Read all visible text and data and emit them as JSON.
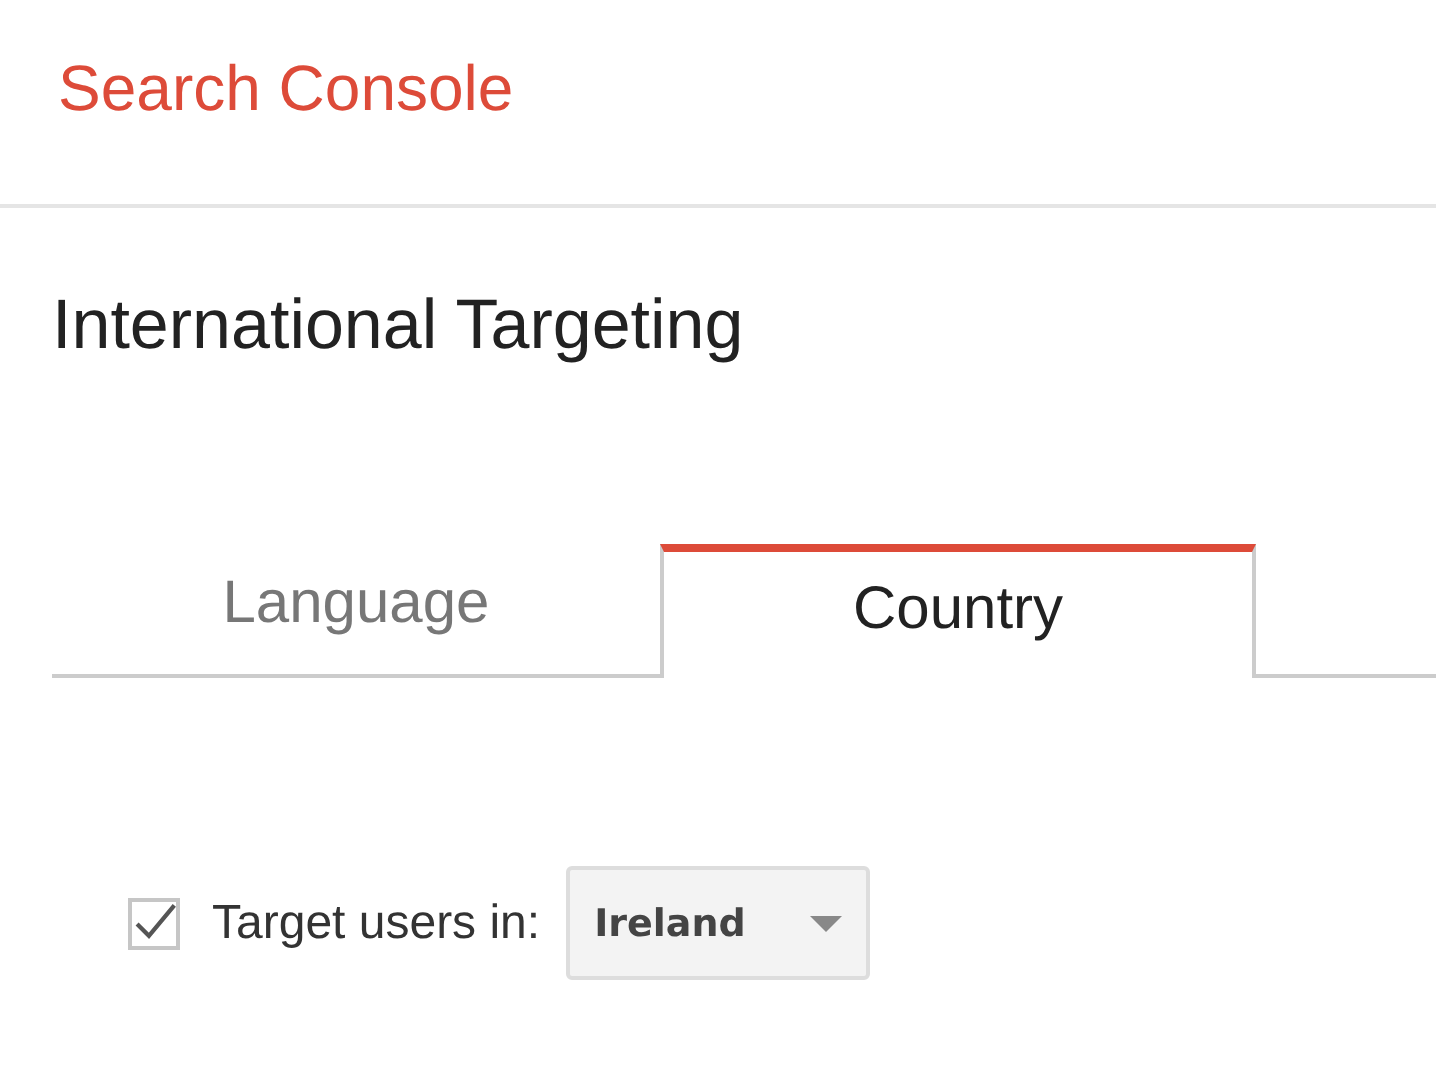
{
  "header": {
    "title": "Search Console"
  },
  "page": {
    "title": "International Targeting"
  },
  "tabs": [
    {
      "label": "Language",
      "selected": false
    },
    {
      "label": "Country",
      "selected": true
    }
  ],
  "target": {
    "checked": true,
    "label": "Target users in:",
    "country": "Ireland"
  }
}
